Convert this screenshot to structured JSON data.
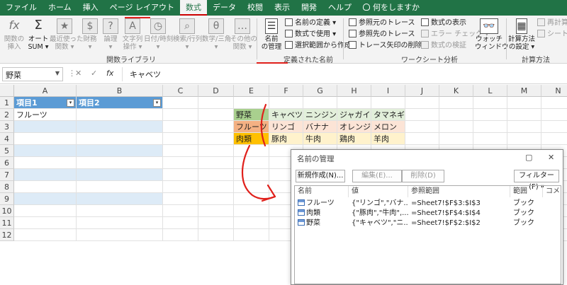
{
  "tabs": [
    "ファイル",
    "ホーム",
    "挿入",
    "ページ レイアウト",
    "数式",
    "データ",
    "校閲",
    "表示",
    "開発",
    "ヘルプ",
    "何をしますか"
  ],
  "active_tab": "数式",
  "ribbon": {
    "func_buttons": [
      {
        "label": "関数の\n挿入",
        "icon": "fx"
      },
      {
        "label": "オート\nSUM ▾",
        "icon": "Σ"
      },
      {
        "label": "最近使った\n関数 ▾",
        "icon": "★"
      },
      {
        "label": "財務\n▾",
        "icon": "$"
      },
      {
        "label": "論理\n▾",
        "icon": "?"
      },
      {
        "label": "文字列\n操作 ▾",
        "icon": "A"
      },
      {
        "label": "日付/時刻\n▾",
        "icon": "◷"
      },
      {
        "label": "検索/行列\n▾",
        "icon": "⌕"
      },
      {
        "label": "数学/三角\n▾",
        "icon": "θ"
      },
      {
        "label": "その他の\n関数 ▾",
        "icon": "…"
      }
    ],
    "group_func_library": "関数ライブラリ",
    "name_manager_label": "名前\nの管理",
    "define_name": "名前の定義 ▾",
    "use_in_formula": "数式で使用 ▾",
    "create_from_selection": "選択範囲から作成",
    "group_defined_names": "定義された名前",
    "trace_precedents": "参照元のトレース",
    "trace_dependents": "参照先のトレース",
    "remove_arrows": "トレース矢印の削除 ▾",
    "show_formulas": "数式の表示",
    "error_checking": "エラー チェック ▾",
    "evaluate_formula": "数式の検証",
    "watch_window": "ウォッチ\nウィンドウ",
    "group_formula_auditing": "ワークシート分析",
    "calc_options": "計算方法\nの設定 ▾",
    "calc_now": "再計算実行",
    "calc_sheet": "シート再計算",
    "group_calculation": "計算方法"
  },
  "formula_bar": {
    "name_box": "野菜",
    "cancel": "✕",
    "enter": "✓",
    "fx": "fx",
    "content": "キャベツ"
  },
  "columns": [
    "A",
    "B",
    "C",
    "D",
    "E",
    "F",
    "G",
    "H",
    "I",
    "J",
    "K",
    "L",
    "M",
    "N"
  ],
  "rows": [
    "1",
    "2",
    "3",
    "4",
    "5",
    "6",
    "7",
    "8",
    "9",
    "10",
    "11",
    "12"
  ],
  "table": {
    "header1": "項目1",
    "header2": "項目2",
    "a2": "フルーツ"
  },
  "named_ranges": {
    "row2": [
      "野菜",
      "キャベツ",
      "ニンジン",
      "ジャガイモ",
      "タマネギ"
    ],
    "row3": [
      "フルーツ",
      "リンゴ",
      "バナナ",
      "オレンジ",
      "メロン"
    ],
    "row4": [
      "肉類",
      "豚肉",
      "牛肉",
      "鶏肉",
      "羊肉"
    ]
  },
  "colors": {
    "excel_green": "#217346",
    "veg_label": "#a9d08e",
    "veg_row": "#e2efda",
    "fruit_label": "#f4b183",
    "fruit_row": "#fce4d6",
    "meat_label": "#ffc000",
    "meat_row": "#fff2cc",
    "table_header": "#5b9bd5",
    "table_band": "#ddebf7",
    "annotation_red": "#e0201b"
  },
  "dialog": {
    "title": "名前の管理",
    "minimize": "▢",
    "close": "✕",
    "new_button": "新規作成(N)...",
    "edit_button": "編集(E)...",
    "delete_button": "削除(D)",
    "filter_button": "フィルター(F) ▾",
    "columns": [
      "名前",
      "値",
      "参照範囲",
      "範囲",
      "コメ"
    ],
    "entries": [
      {
        "name": "フルーツ",
        "value": "{\"リンゴ\",\"バナ...",
        "ref": "=Sheet7!$F$3:$I$3",
        "scope": "ブック"
      },
      {
        "name": "肉類",
        "value": "{\"豚肉\",\"牛肉\",...",
        "ref": "=Sheet7!$F$4:$I$4",
        "scope": "ブック"
      },
      {
        "name": "野菜",
        "value": "{\"キャベツ\",\"ニ...",
        "ref": "=Sheet7!$F$2:$I$2",
        "scope": "ブック"
      }
    ]
  }
}
